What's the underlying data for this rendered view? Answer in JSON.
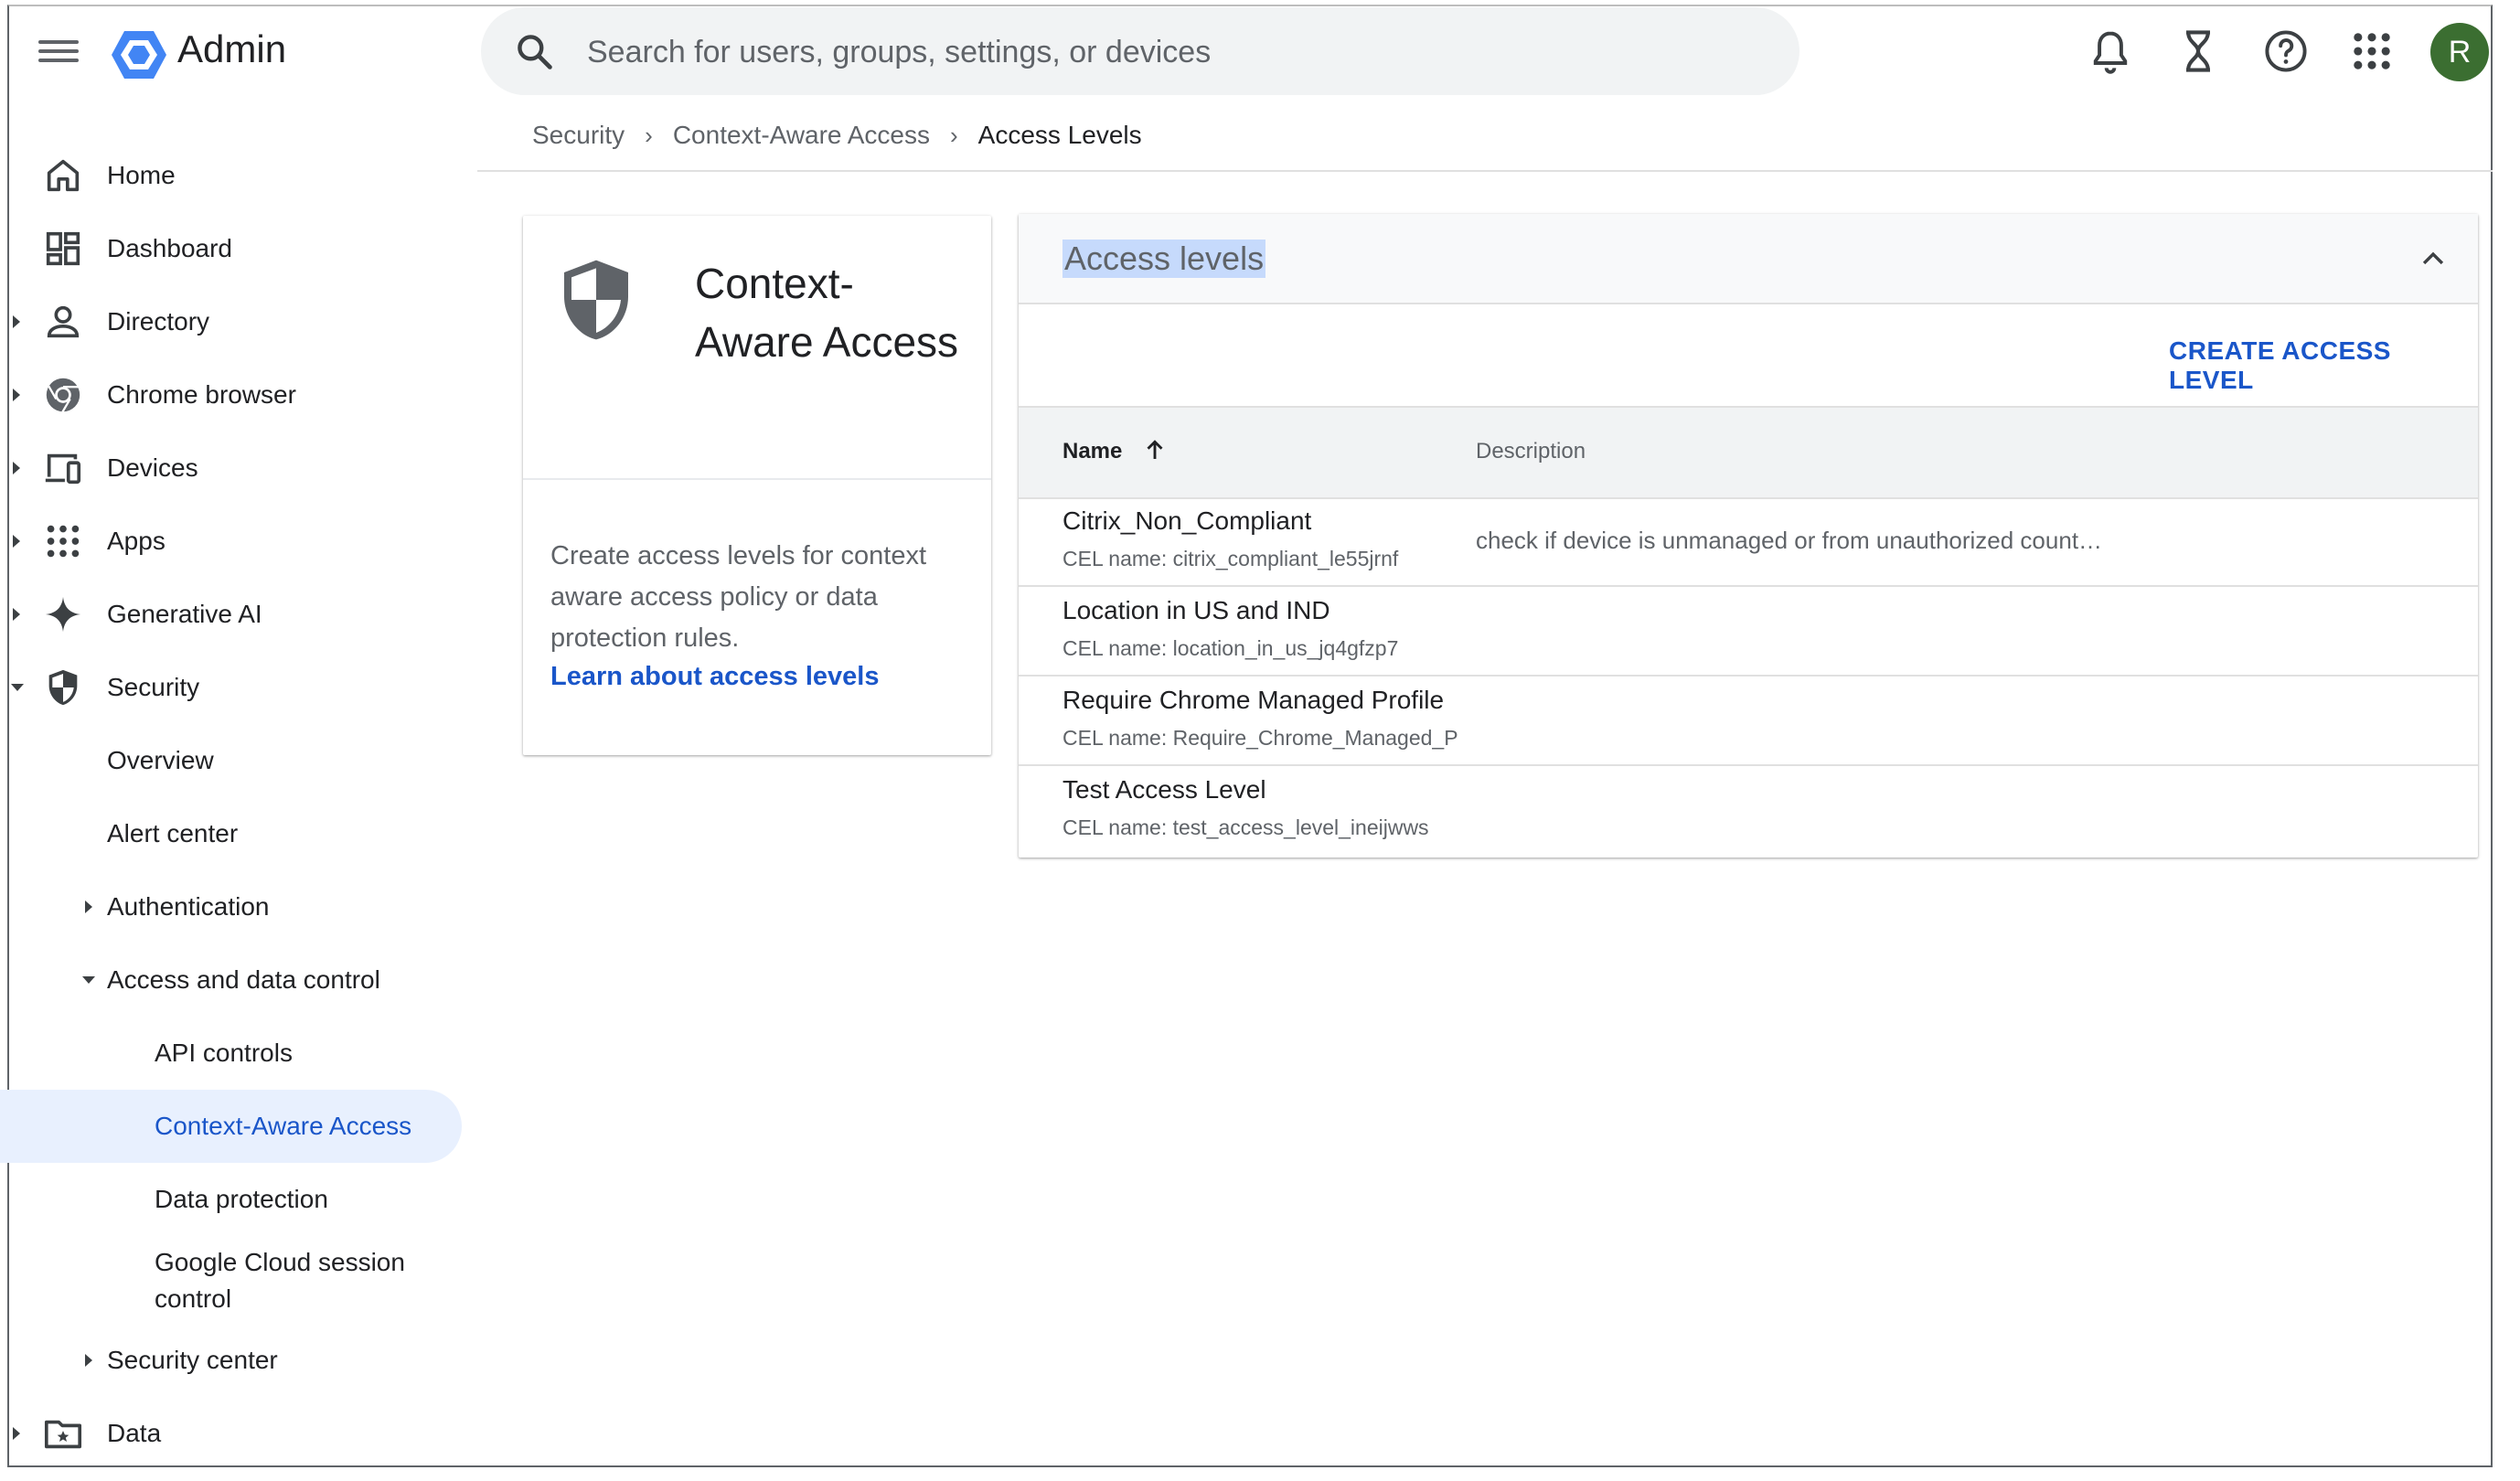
{
  "header": {
    "app_name": "Admin",
    "search_placeholder": "Search for users, groups, settings, or devices",
    "avatar_letter": "R",
    "colors": {
      "avatar_bg": "#3b6e31",
      "logo": "#4285f4"
    }
  },
  "sidebar": {
    "items": [
      {
        "label": "Home",
        "icon": "home-icon"
      },
      {
        "label": "Dashboard",
        "icon": "dashboard-icon"
      },
      {
        "label": "Directory",
        "icon": "person-icon"
      },
      {
        "label": "Chrome browser",
        "icon": "chrome-icon"
      },
      {
        "label": "Devices",
        "icon": "devices-icon"
      },
      {
        "label": "Apps",
        "icon": "apps-grid-icon"
      },
      {
        "label": "Generative AI",
        "icon": "sparkle-icon"
      },
      {
        "label": "Security",
        "icon": "shield-icon"
      },
      {
        "label": "Overview"
      },
      {
        "label": "Alert center"
      },
      {
        "label": "Authentication"
      },
      {
        "label": "Access and data control"
      },
      {
        "label": "API controls"
      },
      {
        "label": "Context-Aware Access"
      },
      {
        "label": "Data protection"
      },
      {
        "label": "Google Cloud session control"
      },
      {
        "label": "Security center"
      },
      {
        "label": "Data",
        "icon": "folder-star-icon"
      }
    ],
    "active_item": "Context-Aware Access"
  },
  "breadcrumb": [
    "Security",
    "Context-Aware Access",
    "Access Levels"
  ],
  "info_card": {
    "title": "Context-Aware Access",
    "description": "Create access levels for context aware access policy or data protection rules.",
    "link": "Learn about access levels"
  },
  "access_levels": {
    "title": "Access levels",
    "create_button": "CREATE ACCESS LEVEL",
    "columns": [
      "Name",
      "Description"
    ],
    "rows": [
      {
        "name": "Citrix_Non_Compliant",
        "cel": "CEL name: citrix_compliant_le55jrnf",
        "description": "check if device is unmanaged or from unauthorized count…"
      },
      {
        "name": "Location in US and IND",
        "cel": "CEL name: location_in_us_jq4gfzp7",
        "description": ""
      },
      {
        "name": "Require Chrome Managed Profile",
        "cel": "CEL name: Require_Chrome_Managed_P",
        "description": ""
      },
      {
        "name": "Test Access Level",
        "cel": "CEL name: test_access_level_ineijwws",
        "description": ""
      }
    ]
  }
}
